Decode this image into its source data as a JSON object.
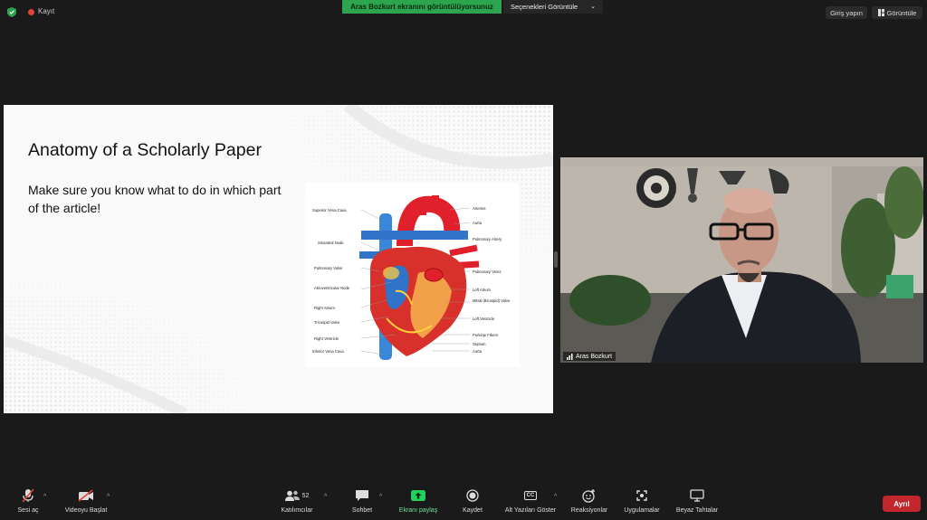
{
  "top_bar": {
    "recording_label": "Kayıt",
    "share_banner": "Aras Bozkurt ekranını görüntülüyorsunuz",
    "view_options": "Seçenekleri Görüntüle",
    "sign_in": "Giriş yapın",
    "view": "Görüntüle"
  },
  "slide": {
    "title": "Anatomy of a Scholarly Paper",
    "body": "Make sure you know what to do in which part of the article!",
    "diagram_labels": {
      "left": [
        "Superior Vena Cava",
        "Sinoatrial Node",
        "Pulmonary Valve",
        "Atrioventricular Node",
        "Right Atrium",
        "Tricuspid Valve",
        "Right Ventricle",
        "Inferior Vena Cava"
      ],
      "right": [
        "Arteries",
        "Aorta",
        "Pulmonary Artery",
        "Pulmonary Veins",
        "Left Atrium",
        "Mitral (Bicuspid) Valve",
        "Left Ventricle",
        "Purkinje Fibers",
        "Septum",
        "Aorta"
      ]
    }
  },
  "video": {
    "participant_name": "Aras Bozkurt"
  },
  "toolbar": {
    "audio": "Sesi aç",
    "video": "Videoyu Başlat",
    "participants": "Katılımcılar",
    "participants_count": "52",
    "chat": "Sohbet",
    "share": "Ekranı paylaş",
    "record": "Kaydet",
    "captions": "Alt Yazıları Göster",
    "captions_icon": "CC",
    "reactions": "Reaksiyonlar",
    "apps": "Uygulamalar",
    "whiteboard": "Beyaz Tahtalar",
    "leave": "Ayrıl"
  },
  "colors": {
    "share_banner": "#2da44e",
    "leave": "#c1272d",
    "share_icon": "#23d160"
  },
  "icons": [
    "shield-icon",
    "mic-muted-icon",
    "video-off-icon",
    "people-icon",
    "chat-icon",
    "share-screen-icon",
    "record-icon",
    "cc-icon",
    "reaction-icon",
    "apps-icon",
    "whiteboard-icon"
  ]
}
